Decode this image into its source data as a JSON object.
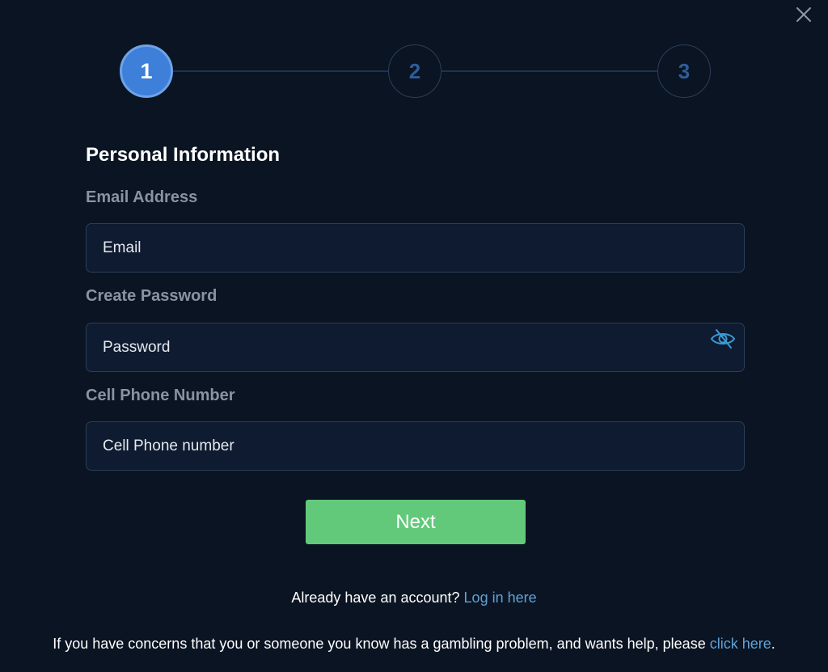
{
  "stepper": {
    "steps": [
      "1",
      "2",
      "3"
    ],
    "active_step": 1
  },
  "form": {
    "title": "Personal Information",
    "email": {
      "label": "Email Address",
      "placeholder": "Email",
      "value": ""
    },
    "password": {
      "label": "Create Password",
      "placeholder": "Password",
      "value": ""
    },
    "phone": {
      "label": "Cell Phone Number",
      "placeholder": "Cell Phone number",
      "value": ""
    },
    "next_label": "Next"
  },
  "footer": {
    "login_prompt": "Already have an account?",
    "login_link": "Log in here",
    "help_text": "If you have concerns that you or someone you know has a gambling problem, and wants help, please",
    "help_link": "click here",
    "help_end": "."
  },
  "icons": {
    "close": "close-icon",
    "password_toggle": "eye-slash-icon"
  },
  "colors": {
    "background": "#0b1422",
    "active_step": "#3d7fd9",
    "inactive_step_text": "#2e5d99",
    "next_button": "#62c97a",
    "link": "#5fa2d6",
    "label": "#8a93a0"
  }
}
